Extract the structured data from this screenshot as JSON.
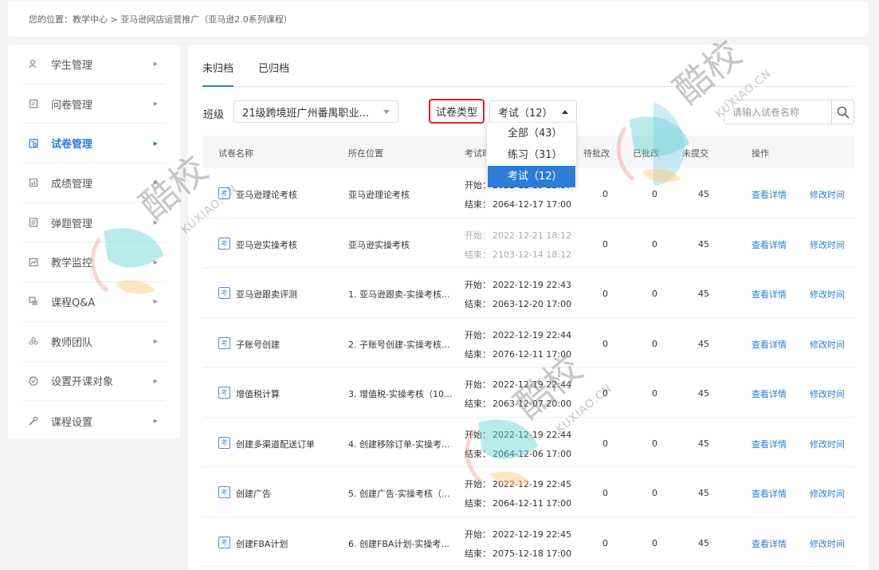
{
  "breadcrumb": {
    "text": "您的位置：教学中心 > 亚马逊网店运营推广（亚马逊2.0系列课程）"
  },
  "sidebar": {
    "items": [
      {
        "label": "学生管理",
        "icon": "student-icon",
        "active": false
      },
      {
        "label": "问卷管理",
        "icon": "questionnaire-icon",
        "active": false
      },
      {
        "label": "试卷管理",
        "icon": "exam-paper-icon",
        "active": true
      },
      {
        "label": "成绩管理",
        "icon": "grades-icon",
        "active": false
      },
      {
        "label": "弹题管理",
        "icon": "popup-question-icon",
        "active": false
      },
      {
        "label": "教学监控",
        "icon": "monitor-icon",
        "active": false
      },
      {
        "label": "课程Q&A",
        "icon": "qa-icon",
        "active": false
      },
      {
        "label": "教师团队",
        "icon": "team-icon",
        "active": false
      },
      {
        "label": "设置开课对象",
        "icon": "target-icon",
        "active": false
      },
      {
        "label": "课程设置",
        "icon": "wrench-icon",
        "active": false
      }
    ]
  },
  "tabs": [
    {
      "label": "未归档",
      "active": true
    },
    {
      "label": "已归档",
      "active": false
    }
  ],
  "filters": {
    "class_label": "班级",
    "class_value": "21级跨境班广州番禺职业...",
    "type_label": "试卷类型",
    "type_value": "考试（12）",
    "search_placeholder": "请输入试卷名称"
  },
  "dropdown": {
    "options": [
      {
        "label": "全部（43）",
        "selected": false
      },
      {
        "label": "练习（31）",
        "selected": false
      },
      {
        "label": "考试（12）",
        "selected": true
      }
    ]
  },
  "table": {
    "headers": [
      "试卷名称",
      "所在位置",
      "考试时",
      "待批改",
      "已批改",
      "未提交",
      "操作"
    ],
    "badge": "考",
    "start_label": "开始：",
    "end_label": "结束：",
    "view_label": "查看详情",
    "edit_label": "修改时间",
    "rows": [
      {
        "name": "亚马逊理论考核",
        "location": "亚马逊理论考核",
        "start": "2022-12-19 22:37",
        "end": "2064-12-17 17:00",
        "pending": "0",
        "graded": "0",
        "unsubmitted": "45",
        "disabled": false
      },
      {
        "name": "亚马逊实操考核",
        "location": "亚马逊实操考核",
        "start": "2022-12-21 18:12",
        "end": "2103-12-14 18:12",
        "pending": "0",
        "graded": "0",
        "unsubmitted": "45",
        "disabled": true
      },
      {
        "name": "亚马逊跟卖评测",
        "location": "1. 亚马逊跟卖-实操考核...",
        "start": "2022-12-19 22:43",
        "end": "2063-12-20 17:00",
        "pending": "0",
        "graded": "0",
        "unsubmitted": "45",
        "disabled": false
      },
      {
        "name": "子账号创建",
        "location": "2. 子账号创建-实操考核...",
        "start": "2022-12-19 22:44",
        "end": "2076-12-11 17:00",
        "pending": "0",
        "graded": "0",
        "unsubmitted": "45",
        "disabled": false
      },
      {
        "name": "增值税计算",
        "location": "3. 增值税-实操考核（10...",
        "start": "2022-12-19 22:44",
        "end": "2063-12-07 20:00",
        "pending": "0",
        "graded": "0",
        "unsubmitted": "45",
        "disabled": false
      },
      {
        "name": "创建多渠道配送订单",
        "location": "4. 创建移除订单-实操考...",
        "start": "2022-12-19 22:44",
        "end": "2064-12-06 17:00",
        "pending": "0",
        "graded": "0",
        "unsubmitted": "45",
        "disabled": false
      },
      {
        "name": "创建广告",
        "location": "5. 创建广告-实操考核（...",
        "start": "2022-12-19 22:45",
        "end": "2064-12-11 17:00",
        "pending": "0",
        "graded": "0",
        "unsubmitted": "45",
        "disabled": false
      },
      {
        "name": "创建FBA计划",
        "location": "6. 创建FBA计划-实操考...",
        "start": "2022-12-19 22:45",
        "end": "2075-12-18 17:00",
        "pending": "0",
        "graded": "0",
        "unsubmitted": "45",
        "disabled": false
      }
    ]
  },
  "watermark": {
    "text": "酷校",
    "sub": "KUXIAO.CN"
  },
  "colors": {
    "accent": "#2d7cd8",
    "highlight_border": "#e02020",
    "background": "#f2f3f5"
  }
}
